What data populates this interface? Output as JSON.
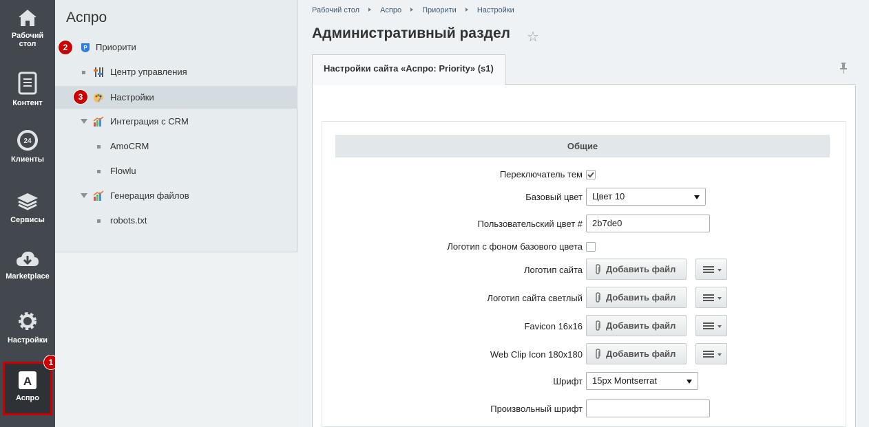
{
  "leftnav": {
    "items": [
      {
        "label": "Рабочий стол",
        "icon": "home-icon"
      },
      {
        "label": "Контент",
        "icon": "document-icon"
      },
      {
        "label": "Клиенты",
        "icon": "clock-24-icon"
      },
      {
        "label": "Сервисы",
        "icon": "layers-icon"
      },
      {
        "label": "Marketplace",
        "icon": "cloud-download-icon"
      },
      {
        "label": "Настройки",
        "icon": "gear-icon"
      },
      {
        "label": "Аспро",
        "icon": "aspro-a-icon",
        "active": true,
        "badge": "1"
      }
    ]
  },
  "menu": {
    "title": "Аспро",
    "items": [
      {
        "label": "Приорити",
        "badge": "2"
      },
      {
        "label": "Центр управления"
      },
      {
        "label": "Настройки",
        "badge": "3",
        "selected": true
      },
      {
        "label": "Интеграция с CRM"
      },
      {
        "label": "AmoCRM"
      },
      {
        "label": "Flowlu"
      },
      {
        "label": "Генерация файлов"
      },
      {
        "label": "robots.txt"
      }
    ]
  },
  "breadcrumbs": [
    "Рабочий стол",
    "Аспро",
    "Приорити",
    "Настройки"
  ],
  "page_title": "Административный раздел",
  "tab": {
    "label": "Настройки сайта «Аспро: Priority» (s1)"
  },
  "section": {
    "title": "Общие"
  },
  "form": {
    "theme_switch_label": "Переключатель тем",
    "theme_switch_checked": true,
    "base_color_label": "Базовый цвет",
    "base_color_value": "Цвет 10",
    "custom_color_label": "Пользовательский цвет #",
    "custom_color_value": "2b7de0",
    "logo_bg_label": "Логотип с фоном базового цвета",
    "logo_bg_checked": false,
    "add_file_label": "Добавить файл",
    "files": [
      {
        "label": "Логотип сайта"
      },
      {
        "label": "Логотип сайта светлый"
      },
      {
        "label": "Favicon 16x16"
      },
      {
        "label": "Web Clip Icon 180x180"
      }
    ],
    "font_label": "Шрифт",
    "font_value": "15px Montserrat",
    "custom_font_label": "Произвольный шрифт",
    "custom_font_value": ""
  },
  "colors": {
    "accent_red": "#cc0000",
    "nav_bg": "#42484d",
    "link": "#3d5a73"
  }
}
